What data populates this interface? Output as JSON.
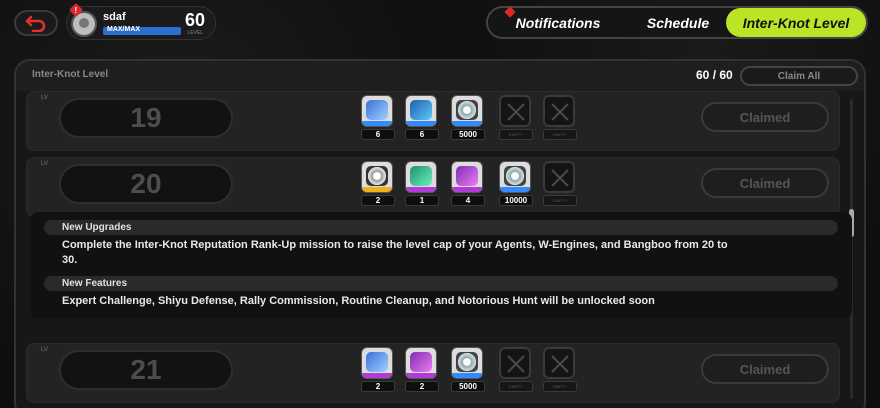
{
  "header": {
    "username": "sdaf",
    "level": "60",
    "level_tag": "LEVEL",
    "exp_label": "MAX/MAX",
    "alert_mark": "!"
  },
  "tabs": [
    {
      "label": "Notifications",
      "active": false,
      "alert": true
    },
    {
      "label": "Schedule",
      "active": false,
      "alert": false
    },
    {
      "label": "Inter-Knot Level",
      "active": true,
      "alert": false
    }
  ],
  "panel": {
    "title": "Inter-Knot Level",
    "progress_current": "60",
    "progress_sep": " / ",
    "progress_total": "60",
    "claim_all_label": "Claim All"
  },
  "rows": [
    {
      "level": "19",
      "status": "Claimed",
      "rewards": [
        {
          "icon": "car-blue-icon",
          "qty": "6",
          "rarity": "blue"
        },
        {
          "icon": "car-cyan-icon",
          "qty": "6",
          "rarity": "blue"
        },
        {
          "icon": "wheel-icon",
          "qty": "5000",
          "rarity": "blue"
        },
        {
          "icon": "empty-slot-icon",
          "qty": "EMPTY",
          "rarity": "none"
        },
        {
          "icon": "empty-slot-icon",
          "qty": "EMPTY",
          "rarity": "none"
        }
      ]
    },
    {
      "level": "20",
      "status": "Claimed",
      "rewards": [
        {
          "icon": "wheel-gold-icon",
          "qty": "2",
          "rarity": "gold"
        },
        {
          "icon": "key-green-icon",
          "qty": "1",
          "rarity": "purple"
        },
        {
          "icon": "car-pink-icon",
          "qty": "4",
          "rarity": "purple"
        },
        {
          "icon": "wheel-icon",
          "qty": "10000",
          "rarity": "blue"
        },
        {
          "icon": "empty-slot-icon",
          "qty": "EMPTY",
          "rarity": "none"
        }
      ]
    },
    {
      "level": "21",
      "status": "Claimed",
      "rewards": [
        {
          "icon": "car-blue-icon",
          "qty": "2",
          "rarity": "purple"
        },
        {
          "icon": "car-pink-icon",
          "qty": "2",
          "rarity": "purple"
        },
        {
          "icon": "wheel-icon",
          "qty": "5000",
          "rarity": "blue"
        },
        {
          "icon": "empty-slot-icon",
          "qty": "EMPTY",
          "rarity": "none"
        },
        {
          "icon": "empty-slot-icon",
          "qty": "EMPTY",
          "rarity": "none"
        }
      ]
    }
  ],
  "details": {
    "upgrades_title": "New Upgrades",
    "upgrades_line1": "Complete the Inter-Knot Reputation Rank-Up mission to raise the level cap of your Agents, W-Engines, and Bangboo from 20 to",
    "upgrades_line2": "30.",
    "features_title": "New Features",
    "features_text": "Expert Challenge, Shiyu Defense, Rally Commission, Routine Cleanup, and Notorious Hunt will be unlocked soon"
  },
  "colors": {
    "accent_tab": "#b9e526",
    "alert_red": "#d62a2a",
    "exp_bar": "#2c6ecf"
  }
}
